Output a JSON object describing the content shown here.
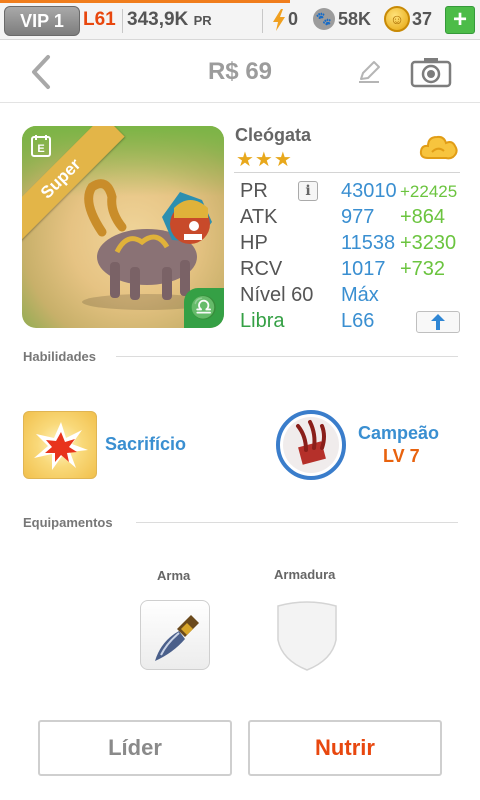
{
  "status_bar": {
    "vip": "VIP 1",
    "level": "L61",
    "power": "343,9K",
    "power_unit": "PR",
    "energy": "0",
    "paw": "58K",
    "coins": "37",
    "add_label": "+"
  },
  "header": {
    "title": "R$ 69"
  },
  "monster": {
    "name": "Cleógata",
    "stars": "★★★",
    "badge": "Super",
    "sign_symbol": "♎",
    "stats": [
      {
        "label": "PR",
        "value": "43010",
        "bonus": "+22425"
      },
      {
        "label": "ATK",
        "value": "977",
        "bonus": "+864"
      },
      {
        "label": "HP",
        "value": "11538",
        "bonus": "+3230"
      },
      {
        "label": "RCV",
        "value": "1017",
        "bonus": "+732"
      }
    ],
    "level_label": "Nível 60",
    "level_value": "Máx",
    "sign_label": "Libra",
    "sign_value": "L66",
    "info_label": "i"
  },
  "abilities": {
    "title": "Habilidades",
    "skills": [
      {
        "name": "Sacrifício"
      },
      {
        "name": "Campeão",
        "level": "LV 7"
      }
    ]
  },
  "equipment": {
    "title": "Equipamentos",
    "weapon_label": "Arma",
    "armor_label": "Armadura"
  },
  "actions": {
    "leader": "Líder",
    "feed": "Nutrir"
  },
  "colors": {
    "accent_orange": "#e8470e",
    "stat_blue": "#3a8fd1",
    "bonus_green": "#6bc43f",
    "libra_green": "#35a045"
  }
}
